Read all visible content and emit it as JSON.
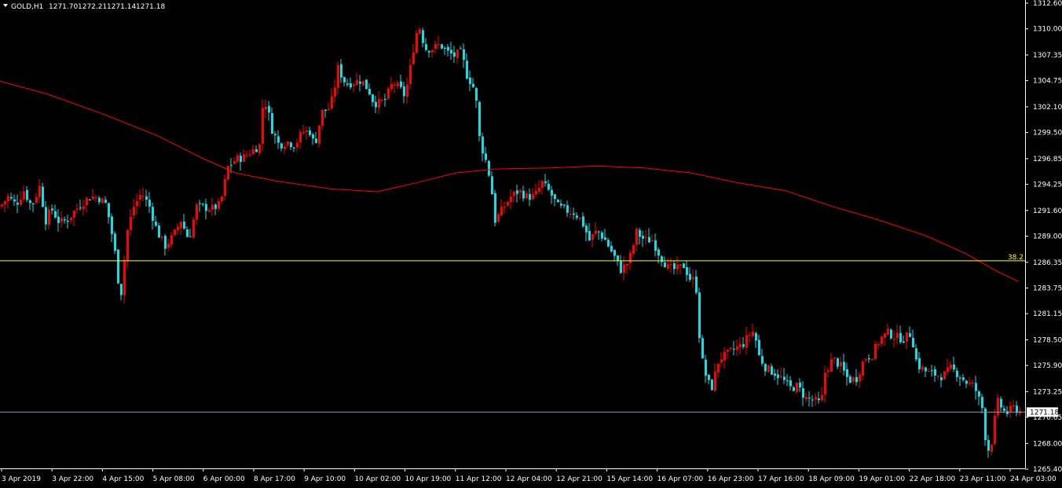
{
  "header": {
    "symbol": "GOLD,H1",
    "open": "1271.70",
    "high": "1272.21",
    "low": "1271.14",
    "close": "1271.18"
  },
  "colors": {
    "background": "#000000",
    "bull_candle": "#ff0000",
    "bear_candle": "#00e5ee",
    "moving_average": "#ff0000",
    "fib_line": "#ffff00",
    "current_price_line": "#8899aa",
    "axis": "#ffffff"
  },
  "chart_data": {
    "type": "candlestick",
    "symbol": "GOLD",
    "timeframe": "H1",
    "ylim": [
      1265.4,
      1312.6
    ],
    "y_ticks": [
      "1312.60",
      "1310.00",
      "1307.35",
      "1304.75",
      "1302.10",
      "1299.50",
      "1296.85",
      "1294.25",
      "1291.60",
      "1289.00",
      "1286.35",
      "1283.75",
      "1281.15",
      "1278.50",
      "1275.90",
      "1273.25",
      "1270.65",
      "1268.00",
      "1265.40"
    ],
    "x_ticks": [
      "3 Apr 2019",
      "3 Apr 22:00",
      "4 Apr 15:00",
      "5 Apr 08:00",
      "6 Apr 00:00",
      "8 Apr 17:00",
      "9 Apr 10:00",
      "10 Apr 02:00",
      "10 Apr 19:00",
      "11 Apr 12:00",
      "12 Apr 04:00",
      "12 Apr 21:00",
      "15 Apr 14:00",
      "16 Apr 07:00",
      "16 Apr 23:00",
      "17 Apr 16:00",
      "18 Apr 09:00",
      "19 Apr 01:00",
      "22 Apr 18:00",
      "23 Apr 11:00",
      "24 Apr 03:00"
    ],
    "current_price": "1271.18",
    "fib_level": {
      "label": "38.2",
      "price": 1286.5
    },
    "close_path": [
      [
        0,
        1292.0
      ],
      [
        10,
        1293.0
      ],
      [
        20,
        1292.2
      ],
      [
        30,
        1293.6
      ],
      [
        40,
        1292.0
      ],
      [
        50,
        1294.0
      ],
      [
        58,
        1290.6
      ],
      [
        65,
        1291.8
      ],
      [
        75,
        1290.4
      ],
      [
        85,
        1290.6
      ],
      [
        95,
        1291.6
      ],
      [
        105,
        1292.4
      ],
      [
        115,
        1293.0
      ],
      [
        125,
        1292.9
      ],
      [
        135,
        1292.2
      ],
      [
        145,
        1288.0
      ],
      [
        150,
        1284.6
      ],
      [
        155,
        1283.0
      ],
      [
        160,
        1289.0
      ],
      [
        170,
        1292.0
      ],
      [
        180,
        1293.4
      ],
      [
        190,
        1292.0
      ],
      [
        200,
        1289.4
      ],
      [
        210,
        1288.0
      ],
      [
        220,
        1289.0
      ],
      [
        230,
        1290.6
      ],
      [
        240,
        1288.6
      ],
      [
        250,
        1292.0
      ],
      [
        260,
        1291.9
      ],
      [
        270,
        1291.8
      ],
      [
        280,
        1292.2
      ],
      [
        290,
        1296.0
      ],
      [
        300,
        1296.8
      ],
      [
        310,
        1297.0
      ],
      [
        320,
        1297.6
      ],
      [
        330,
        1298.2
      ],
      [
        335,
        1303.0
      ],
      [
        340,
        1302.0
      ],
      [
        345,
        1300.0
      ],
      [
        355,
        1298.2
      ],
      [
        365,
        1298.6
      ],
      [
        375,
        1298.2
      ],
      [
        385,
        1299.6
      ],
      [
        395,
        1299.6
      ],
      [
        400,
        1298.0
      ],
      [
        405,
        1300.0
      ],
      [
        410,
        1301.6
      ],
      [
        420,
        1302.0
      ],
      [
        425,
        1303.8
      ],
      [
        430,
        1306.0
      ],
      [
        440,
        1304.4
      ],
      [
        450,
        1304.6
      ],
      [
        460,
        1304.8
      ],
      [
        470,
        1303.6
      ],
      [
        475,
        1302.6
      ],
      [
        480,
        1302.4
      ],
      [
        490,
        1302.8
      ],
      [
        500,
        1304.6
      ],
      [
        510,
        1303.8
      ],
      [
        515,
        1303.2
      ],
      [
        520,
        1305.0
      ],
      [
        525,
        1307.6
      ],
      [
        530,
        1309.6
      ],
      [
        535,
        1310.2
      ],
      [
        540,
        1308.0
      ],
      [
        550,
        1308.0
      ],
      [
        560,
        1308.4
      ],
      [
        570,
        1307.6
      ],
      [
        580,
        1307.2
      ],
      [
        585,
        1307.8
      ],
      [
        590,
        1306.6
      ],
      [
        595,
        1305.0
      ],
      [
        600,
        1304.6
      ],
      [
        605,
        1303.4
      ],
      [
        610,
        1299.0
      ],
      [
        615,
        1297.4
      ],
      [
        620,
        1296.2
      ],
      [
        625,
        1294.0
      ],
      [
        630,
        1290.6
      ],
      [
        640,
        1291.8
      ],
      [
        650,
        1293.0
      ],
      [
        660,
        1293.6
      ],
      [
        670,
        1293.0
      ],
      [
        680,
        1293.0
      ],
      [
        690,
        1294.4
      ],
      [
        700,
        1293.4
      ],
      [
        710,
        1292.0
      ],
      [
        720,
        1291.6
      ],
      [
        730,
        1291.4
      ],
      [
        740,
        1290.6
      ],
      [
        750,
        1288.6
      ],
      [
        760,
        1289.6
      ],
      [
        770,
        1288.6
      ],
      [
        780,
        1287.2
      ],
      [
        790,
        1285.6
      ],
      [
        800,
        1286.4
      ],
      [
        805,
        1287.8
      ],
      [
        810,
        1289.4
      ],
      [
        820,
        1288.6
      ],
      [
        830,
        1288.6
      ],
      [
        840,
        1287.0
      ],
      [
        850,
        1285.8
      ],
      [
        860,
        1285.6
      ],
      [
        870,
        1286.0
      ],
      [
        880,
        1284.4
      ],
      [
        885,
        1284.8
      ],
      [
        890,
        1279.0
      ],
      [
        895,
        1275.6
      ],
      [
        905,
        1273.4
      ],
      [
        915,
        1276.6
      ],
      [
        925,
        1277.0
      ],
      [
        935,
        1277.6
      ],
      [
        945,
        1278.0
      ],
      [
        955,
        1279.2
      ],
      [
        960,
        1279.4
      ],
      [
        965,
        1277.0
      ],
      [
        975,
        1275.6
      ],
      [
        985,
        1275.2
      ],
      [
        995,
        1274.6
      ],
      [
        1005,
        1273.6
      ],
      [
        1015,
        1273.8
      ],
      [
        1025,
        1272.6
      ],
      [
        1035,
        1272.4
      ],
      [
        1045,
        1272.0
      ],
      [
        1050,
        1275.2
      ],
      [
        1060,
        1276.6
      ],
      [
        1070,
        1275.8
      ],
      [
        1080,
        1274.4
      ],
      [
        1090,
        1274.6
      ],
      [
        1100,
        1276.6
      ],
      [
        1110,
        1277.0
      ],
      [
        1120,
        1278.6
      ],
      [
        1130,
        1279.2
      ],
      [
        1140,
        1278.8
      ],
      [
        1150,
        1278.6
      ],
      [
        1160,
        1279.2
      ],
      [
        1165,
        1276.6
      ],
      [
        1170,
        1275.8
      ],
      [
        1180,
        1275.2
      ],
      [
        1190,
        1275.0
      ],
      [
        1200,
        1274.8
      ],
      [
        1210,
        1275.6
      ],
      [
        1220,
        1275.0
      ],
      [
        1230,
        1274.2
      ],
      [
        1240,
        1273.8
      ],
      [
        1250,
        1271.6
      ],
      [
        1255,
        1268.0
      ],
      [
        1260,
        1267.0
      ],
      [
        1265,
        1270.0
      ],
      [
        1270,
        1272.2
      ],
      [
        1280,
        1271.0
      ],
      [
        1290,
        1271.6
      ],
      [
        1300,
        1271.2
      ]
    ],
    "ma_points": [
      [
        0,
        1304.7
      ],
      [
        60,
        1303.4
      ],
      [
        130,
        1301.4
      ],
      [
        200,
        1299.2
      ],
      [
        260,
        1296.8
      ],
      [
        300,
        1295.4
      ],
      [
        350,
        1294.6
      ],
      [
        420,
        1293.8
      ],
      [
        480,
        1293.5
      ],
      [
        530,
        1294.4
      ],
      [
        580,
        1295.4
      ],
      [
        630,
        1295.8
      ],
      [
        700,
        1295.9
      ],
      [
        760,
        1296.1
      ],
      [
        820,
        1295.9
      ],
      [
        880,
        1295.4
      ],
      [
        940,
        1294.4
      ],
      [
        1000,
        1293.6
      ],
      [
        1060,
        1292.0
      ],
      [
        1120,
        1290.6
      ],
      [
        1180,
        1289.0
      ],
      [
        1230,
        1287.2
      ],
      [
        1270,
        1285.4
      ],
      [
        1297,
        1284.4
      ]
    ]
  }
}
